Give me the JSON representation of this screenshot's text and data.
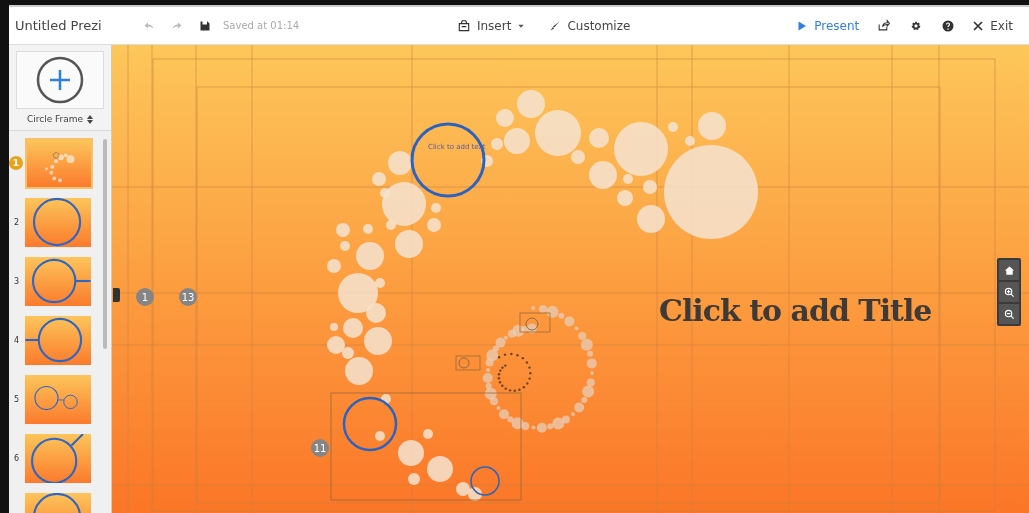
{
  "toolbar": {
    "title": "Untitled Prezi",
    "save_status": "Saved at 01:14",
    "insert": "Insert",
    "customize": "Customize",
    "present": "Present",
    "exit": "Exit"
  },
  "sidebar": {
    "frame_type": "Circle Frame",
    "slides": [
      {
        "number": "1",
        "selected": true,
        "kind": "overview"
      },
      {
        "number": "2",
        "selected": false,
        "kind": "circle"
      },
      {
        "number": "3",
        "selected": false,
        "kind": "link-right"
      },
      {
        "number": "4",
        "selected": false,
        "kind": "link-left"
      },
      {
        "number": "5",
        "selected": false,
        "kind": "pair"
      },
      {
        "number": "6",
        "selected": false,
        "kind": "link-top"
      },
      {
        "selected": false,
        "kind": "circle"
      }
    ]
  },
  "canvas": {
    "title": "Click to add Title",
    "frame_text": "Click to add text",
    "markers": [
      {
        "label": "1",
        "kind": "path"
      },
      {
        "label": "13",
        "kind": "path"
      },
      {
        "label": "11",
        "kind": "path"
      }
    ]
  }
}
